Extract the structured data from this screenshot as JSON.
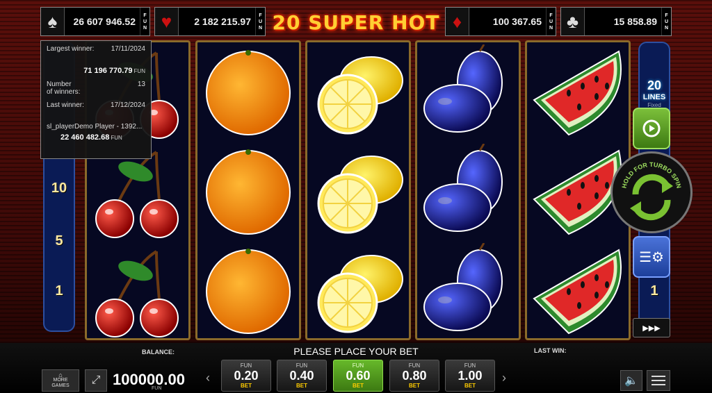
{
  "jackpots": [
    {
      "suit": "spade",
      "glyph": "♠",
      "value": "26 607 946.52",
      "currency": [
        "F",
        "U",
        "N"
      ]
    },
    {
      "suit": "heart",
      "glyph": "♥",
      "value": "2 182 215.97",
      "currency": [
        "F",
        "U",
        "N"
      ]
    },
    {
      "suit": "diamond",
      "glyph": "♦",
      "value": "100 367.65",
      "currency": [
        "F",
        "U",
        "N"
      ]
    },
    {
      "suit": "club",
      "glyph": "♣",
      "value": "15 858.89",
      "currency": [
        "F",
        "U",
        "N"
      ]
    }
  ],
  "logo": "20 SUPER HOT",
  "tooltip": {
    "largest_label": "Largest winner:",
    "largest_date": "17/11/2024",
    "largest_amount": "71 196 770.79",
    "currency": "FUN",
    "number_label_1": "Number",
    "number_label_2": "of winners:",
    "number_value": "13",
    "last_label": "Last winner:",
    "last_date": "17/12/2024",
    "last_player": "sl_playerDemo Player - 1392...",
    "last_amount": "22 460 482.68"
  },
  "left_lines": [
    "10",
    "5",
    "1"
  ],
  "right_panel": {
    "lines_count": "20",
    "lines_label": "LINES",
    "fixed_label": "Fixed",
    "right_line": "1"
  },
  "turbo_text": "HOLD FOR TURBO SPIN",
  "reels": [
    [
      "cherry",
      "cherry",
      "cherry"
    ],
    [
      "orange",
      "orange",
      "orange"
    ],
    [
      "lemon",
      "lemon",
      "lemon"
    ],
    [
      "plum",
      "plum",
      "plum"
    ],
    [
      "watermelon",
      "watermelon",
      "watermelon"
    ]
  ],
  "bottom": {
    "balance_label": "BALANCE:",
    "balance_value": "100000.00",
    "balance_currency": "FUN",
    "place_bet": "PLEASE PLACE YOUR BET",
    "last_win_label": "LAST WIN:",
    "more_games_1": "MORE",
    "more_games_2": "GAMES",
    "bets": [
      {
        "currency": "FUN",
        "value": "0.20",
        "label": "BET",
        "selected": false
      },
      {
        "currency": "FUN",
        "value": "0.40",
        "label": "BET",
        "selected": false
      },
      {
        "currency": "FUN",
        "value": "0.60",
        "label": "BET",
        "selected": true
      },
      {
        "currency": "FUN",
        "value": "0.80",
        "label": "BET",
        "selected": false
      },
      {
        "currency": "FUN",
        "value": "1.00",
        "label": "BET",
        "selected": false
      }
    ],
    "prev_arrow": "‹",
    "next_arrow": "›"
  },
  "icons": [
    "spade-icon",
    "heart-icon",
    "diamond-icon",
    "club-icon",
    "fullscreen-icon",
    "speaker-icon",
    "menu-icon",
    "autoplay-icon",
    "turbo-spin-icon",
    "settings-icon",
    "fast-forward-icon"
  ],
  "colors": {
    "selected_bet": "#5aa822",
    "logo": "#ffcf33",
    "reel_bg": "#060822",
    "jackpot_text": "#eeeeee"
  }
}
